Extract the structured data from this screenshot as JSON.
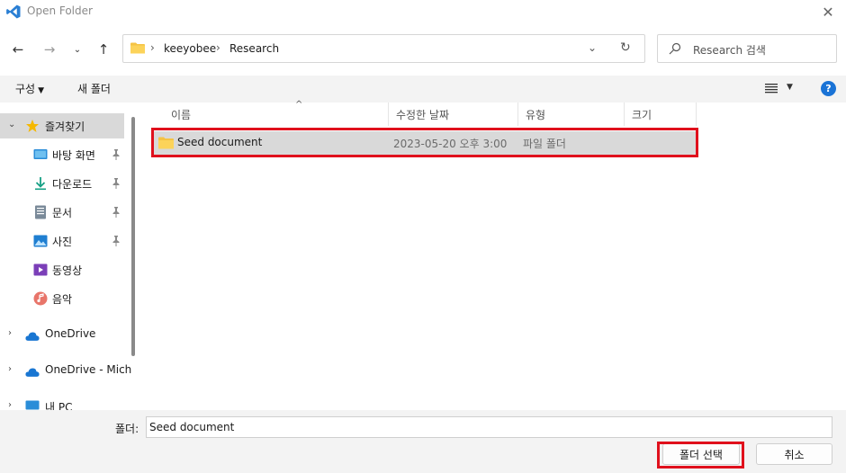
{
  "window": {
    "title": "Open Folder"
  },
  "address": {
    "segments": [
      "keeyobee",
      "Research"
    ]
  },
  "search": {
    "placeholder": "Research 검색"
  },
  "toolbar": {
    "organize": "구성",
    "new_folder": "새 폴더"
  },
  "sidebar": {
    "favorites": "즐겨찾기",
    "items": [
      {
        "label": "바탕 화면",
        "icon": "desktop-icon",
        "pinned": true
      },
      {
        "label": "다운로드",
        "icon": "download-icon",
        "pinned": true
      },
      {
        "label": "문서",
        "icon": "document-icon",
        "pinned": true
      },
      {
        "label": "사진",
        "icon": "picture-icon",
        "pinned": true
      },
      {
        "label": "동영상",
        "icon": "video-icon",
        "pinned": false
      },
      {
        "label": "음악",
        "icon": "music-icon",
        "pinned": false
      }
    ],
    "onedrive": "OneDrive",
    "onedrive_business": "OneDrive - Mich",
    "this_pc": "내 PC"
  },
  "columns": {
    "name": "이름",
    "date": "수정한 날짜",
    "type": "유형",
    "size": "크기"
  },
  "files": [
    {
      "name": "Seed document",
      "date": "2023-05-20 오후 3:00",
      "type": "파일 폴더",
      "size": ""
    }
  ],
  "footer": {
    "folder_label": "폴더:",
    "folder_value": "Seed document",
    "select_button": "폴더 선택",
    "cancel_button": "취소"
  },
  "colors": {
    "accent": "#1a73d6",
    "highlight": "#e0101c",
    "selection": "#d9d9d9",
    "folder": "#f5c344"
  }
}
